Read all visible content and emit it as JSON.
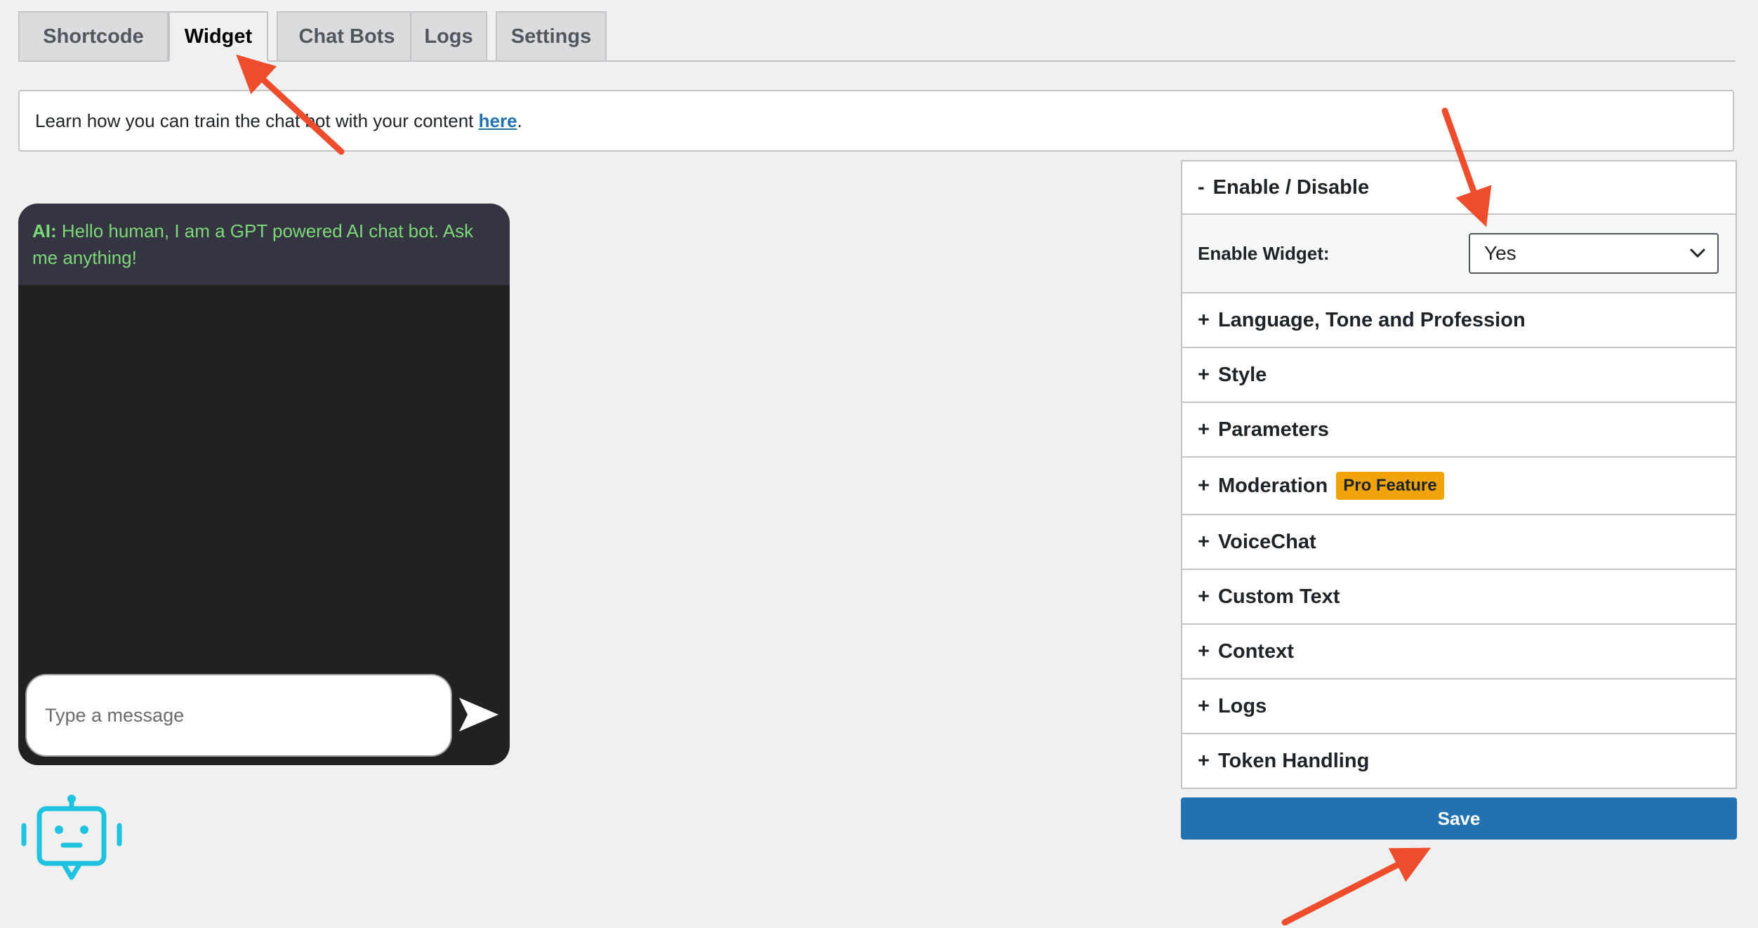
{
  "tabs": [
    {
      "label": "Shortcode",
      "active": false
    },
    {
      "label": "Widget",
      "active": true
    },
    {
      "label": "Chat Bots",
      "active": false
    },
    {
      "label": "Logs",
      "active": false
    },
    {
      "label": "Settings",
      "active": false
    }
  ],
  "notice": {
    "text": "Learn how you can train the chat bot with your content ",
    "link": "here",
    "suffix": "."
  },
  "chat": {
    "sender": "AI:",
    "message": "Hello human, I am a GPT powered AI chat bot. Ask me anything!",
    "input_placeholder": "Type a message"
  },
  "panel": {
    "enable_section": {
      "sign": "-",
      "title": "Enable / Disable"
    },
    "enable_field": {
      "label": "Enable Widget:",
      "value": "Yes"
    },
    "sections": [
      {
        "sign": "+",
        "title": "Language, Tone and Profession"
      },
      {
        "sign": "+",
        "title": "Style"
      },
      {
        "sign": "+",
        "title": "Parameters"
      },
      {
        "sign": "+",
        "title": "Moderation",
        "badge": "Pro Feature"
      },
      {
        "sign": "+",
        "title": "VoiceChat"
      },
      {
        "sign": "+",
        "title": "Custom Text"
      },
      {
        "sign": "+",
        "title": "Context"
      },
      {
        "sign": "+",
        "title": "Logs"
      },
      {
        "sign": "+",
        "title": "Token Handling"
      }
    ],
    "save_label": "Save"
  },
  "colors": {
    "accent": "#2271b1",
    "badge": "#f0a30a",
    "chat_text": "#7dd87a",
    "annotation_arrow": "#ee4d2d",
    "bot_icon": "#1fc3e0"
  },
  "icons": [
    "send-icon",
    "bot-icon",
    "chevron-down-icon"
  ]
}
